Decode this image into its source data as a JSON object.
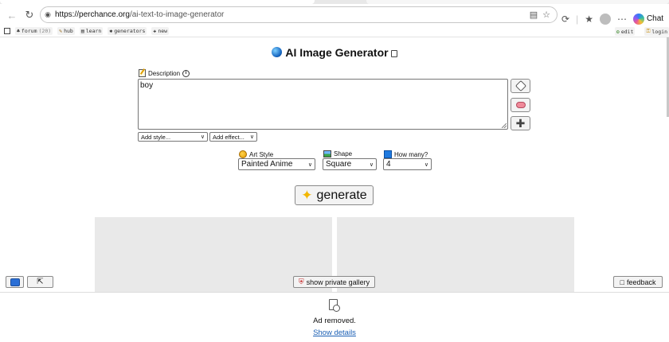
{
  "browser": {
    "url_host": "https://perchance.org",
    "url_path": "/ai-text-to-image-generator",
    "chat_label": "Chat",
    "icons": [
      "back-icon",
      "reload-icon",
      "site-info-icon",
      "reader-icon",
      "favorite-star-icon",
      "copilot-icon",
      "favorites-icon",
      "profile-icon",
      "more-icon"
    ]
  },
  "favbar": {
    "items": [
      {
        "label": "forum",
        "sub": "(20)"
      },
      {
        "label": "hub"
      },
      {
        "label": "learn"
      },
      {
        "label": "generators"
      },
      {
        "label": "new"
      }
    ],
    "right": [
      {
        "label": "edit"
      },
      {
        "label": "login"
      }
    ]
  },
  "app": {
    "title": "AI Image Generator",
    "description_label": "Description",
    "description_value": "boy",
    "add_style": "Add style...",
    "add_effect": "Add effect...",
    "art_style_label": "Art Style",
    "art_style_value": "Painted Anime",
    "shape_label": "Shape",
    "shape_value": "Square",
    "how_many_label": "How many?",
    "how_many_value": "4",
    "generate_label": "generate",
    "private_gallery_label": "show private gallery",
    "feedback_label": "feedback"
  },
  "ad": {
    "text": "Ad removed.",
    "link": "Show details"
  },
  "colors": {
    "accent_link": "#1a5fb4",
    "panel_bg": "#e9e9e9",
    "button_bg": "#f3f3f3"
  }
}
